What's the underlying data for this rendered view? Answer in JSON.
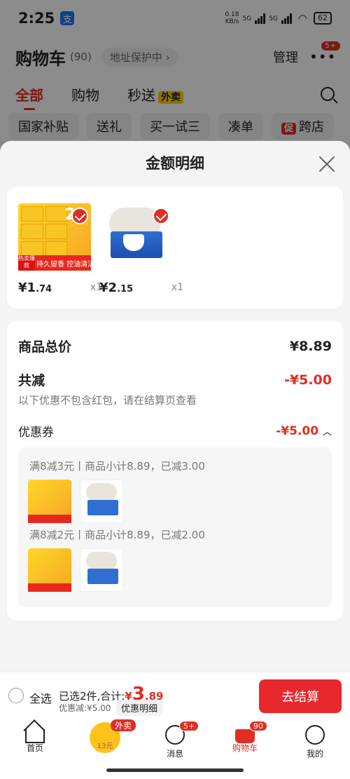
{
  "status": {
    "time": "2:25",
    "speed_value": "0.18",
    "speed_unit": "KB/s",
    "net1": "5G",
    "net2": "5G",
    "battery": "62"
  },
  "header": {
    "title": "购物车",
    "count": "(90)",
    "address": "地址保护中",
    "manage": "管理",
    "more_badge": "5+"
  },
  "tabs": [
    {
      "label": "全部"
    },
    {
      "label": "购物"
    },
    {
      "label": "秒送"
    }
  ],
  "tab_badge": "外卖",
  "chips": [
    {
      "label": "国家补贴"
    },
    {
      "label": "送礼"
    },
    {
      "label": "买一试三"
    },
    {
      "label": "凑单"
    },
    {
      "label": "跨店"
    }
  ],
  "chip_promo_icon": "促",
  "sheet": {
    "title": "金额明细"
  },
  "products": [
    {
      "price_int": "¥1",
      "price_dec": ".74",
      "qty": "x1",
      "img_num": "2",
      "img_hot": "热卖爆款",
      "img_banner": "持久留香 控油清洁"
    },
    {
      "price_int": "¥2",
      "price_dec": ".15",
      "qty": "x1"
    }
  ],
  "summary": {
    "total_label": "商品总价",
    "total_value": "¥8.89",
    "reduce_label": "共减",
    "reduce_value": "-¥5.00",
    "note": "以下优惠不包含红包，请在结算页查看",
    "coupon_label": "优惠券",
    "coupon_value": "-¥5.00"
  },
  "coupons": [
    {
      "text": "满8减3元丨商品小计8.89，已减3.00"
    },
    {
      "text": "满8减2元丨商品小计8.89，已减2.00"
    }
  ],
  "bottom": {
    "select_all": "全选",
    "selected": "已选2件,合计:",
    "yen": "¥",
    "total_int": "3",
    "total_dec": ".89",
    "discount": "优惠减:¥5.00",
    "detail": "优惠明细",
    "checkout": "去结算"
  },
  "nav": [
    {
      "label": "首页"
    },
    {
      "label": "13元",
      "tag": "外卖"
    },
    {
      "label": "消息",
      "badge": "5+"
    },
    {
      "label": "购物车",
      "badge": "90",
      "active": true
    },
    {
      "label": "我的"
    }
  ],
  "colors": {
    "accent": "#e02e24",
    "overlay": "rgba(0,0,0,0.45)"
  }
}
